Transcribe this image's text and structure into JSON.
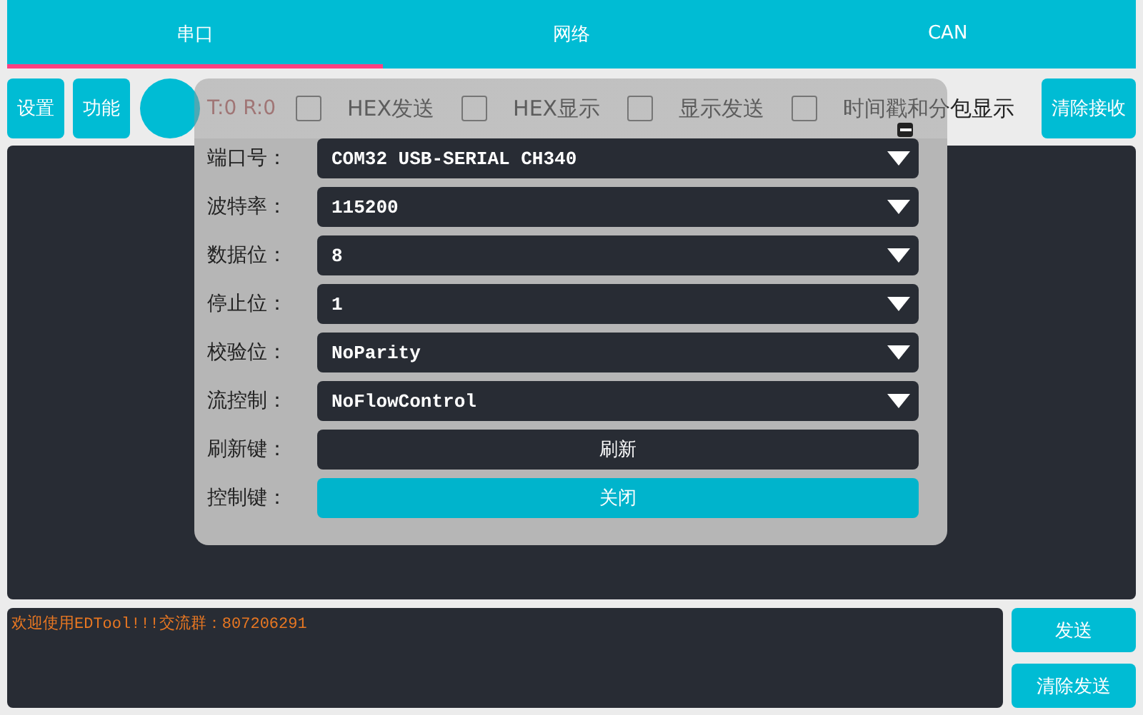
{
  "tabs": [
    {
      "label": "串口",
      "selected": true
    },
    {
      "label": "网络",
      "selected": false
    },
    {
      "label": "CAN",
      "selected": false
    }
  ],
  "toolbar": {
    "buttons": [
      "设置",
      "功能"
    ],
    "counter": "T:0 R:0",
    "options": [
      {
        "label": "HEX发送",
        "checked": false
      },
      {
        "label": "HEX显示",
        "checked": false
      },
      {
        "label": "显示发送",
        "checked": false
      },
      {
        "label": "时间戳和分包显示",
        "checked": false
      }
    ],
    "clear_button": "清除接收"
  },
  "dialog": {
    "rows": [
      {
        "kind": "select",
        "label": "端口号：",
        "value": "COM32 USB-SERIAL CH340"
      },
      {
        "kind": "select",
        "label": "波特率：",
        "value": "115200"
      },
      {
        "kind": "select",
        "label": "数据位：",
        "value": "8"
      },
      {
        "kind": "select",
        "label": "停止位：",
        "value": "1"
      },
      {
        "kind": "select",
        "label": "校验位：",
        "value": "NoParity"
      },
      {
        "kind": "select",
        "label": "流控制：",
        "value": "NoFlowControl"
      },
      {
        "kind": "button",
        "label": "刷新键：",
        "value": "刷新"
      },
      {
        "kind": "primary",
        "label": "控制键：",
        "value": "关闭"
      }
    ]
  },
  "send": {
    "text": "欢迎使用EDTool!!!交流群：807206291",
    "buttons": [
      "发送",
      "清除发送"
    ]
  }
}
